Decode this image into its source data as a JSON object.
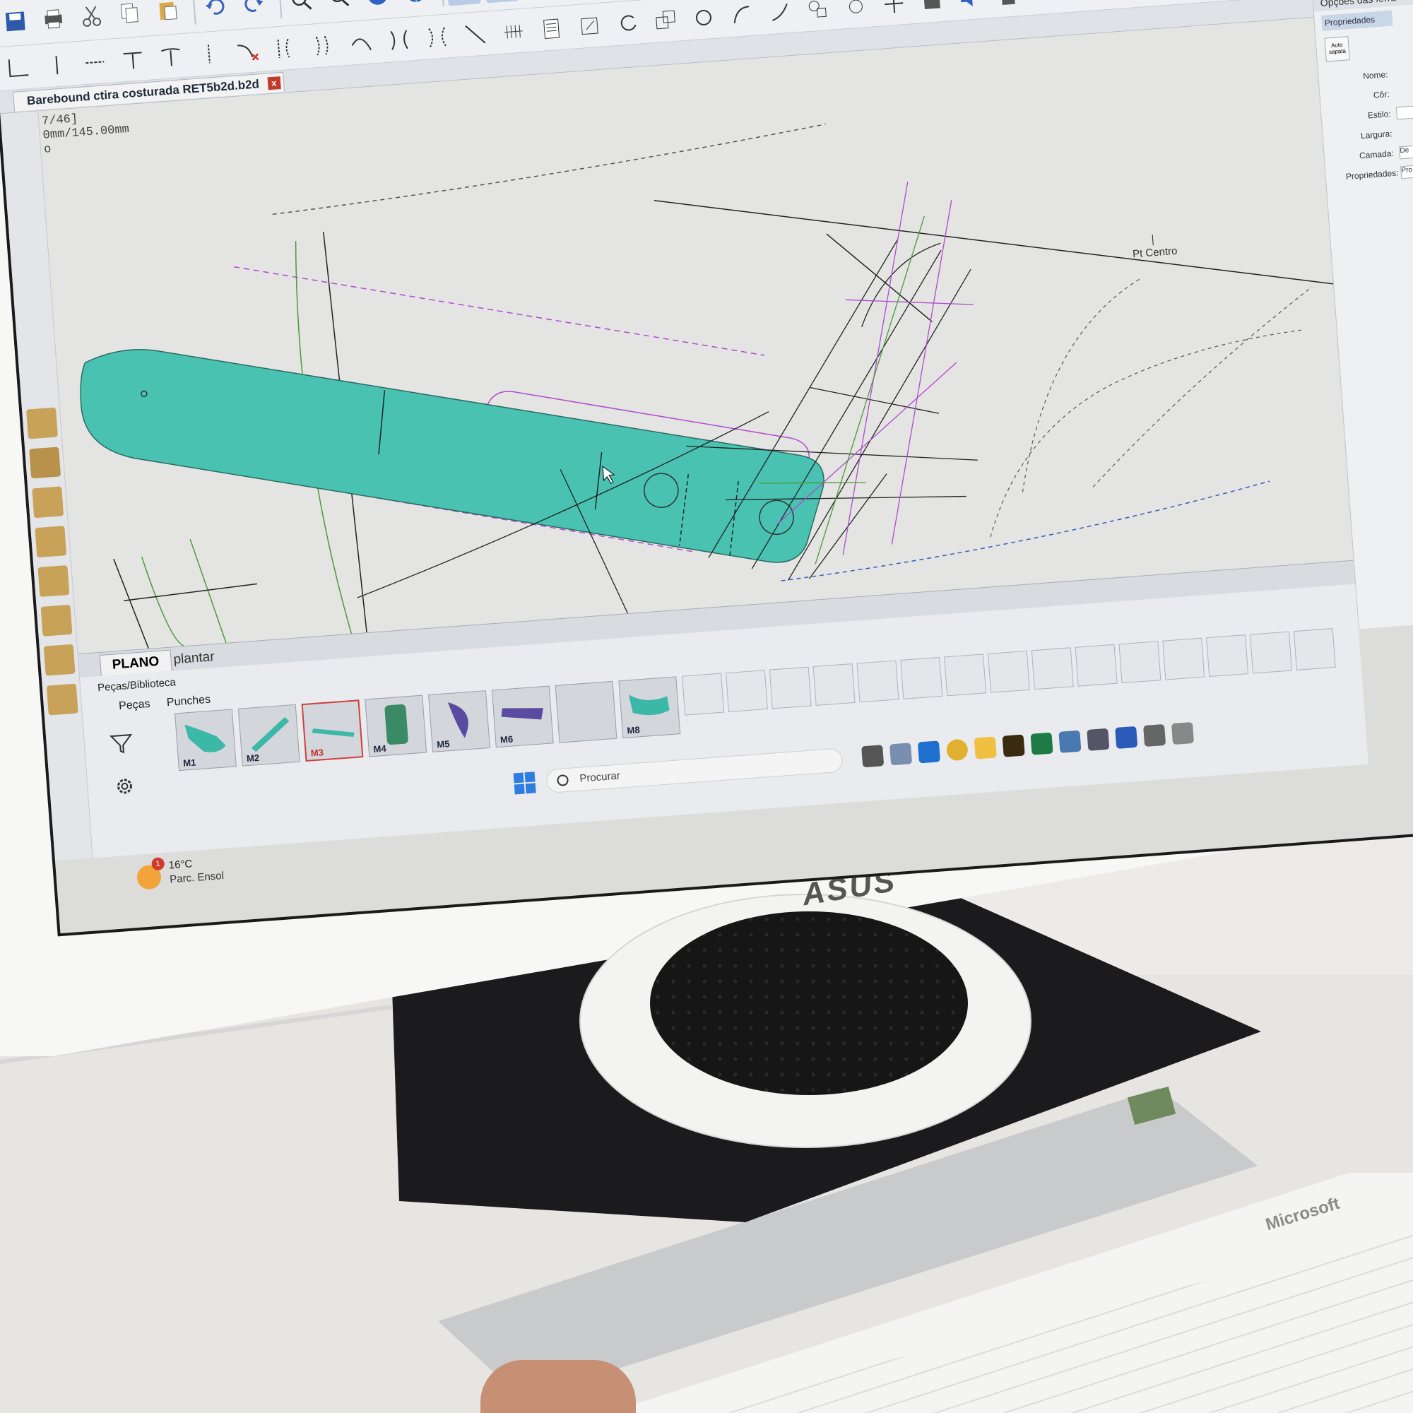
{
  "app": {
    "document_tab": "Barebound ctira costurada RET5b2d.b2d",
    "document_tab_close": "x"
  },
  "canvas": {
    "status_line1": "7/46]",
    "status_line2": "0mm/145.00mm",
    "status_line3": "o",
    "center_point_label": "Pt Centro"
  },
  "right_panel": {
    "header": "Opções das ferra",
    "tab": "Propriedades",
    "auto_button": "Auto sapata",
    "fields": [
      {
        "label": "Nome:"
      },
      {
        "label": "Côr:"
      },
      {
        "label": "Estilo:"
      },
      {
        "label": "Largura:"
      },
      {
        "label": "Camada:",
        "value": "De"
      },
      {
        "label": "Propriedades:",
        "value": "Pro"
      }
    ]
  },
  "bottom_tabs": {
    "active": "PLANO",
    "other": "plantar"
  },
  "library": {
    "title": "Peças/Biblioteca",
    "tabs": [
      "Peças",
      "Punches"
    ],
    "items": [
      {
        "label": "M1",
        "color": "#3bb8a6",
        "selected": false
      },
      {
        "label": "M2",
        "color": "#3bb8a6",
        "selected": false
      },
      {
        "label": "M3",
        "color": "#3bb8a6",
        "selected": true
      },
      {
        "label": "M4",
        "color": "#3a8a66",
        "selected": false
      },
      {
        "label": "M5",
        "color": "#5a4aa0",
        "selected": false
      },
      {
        "label": "M6",
        "color": "#5a4aa0",
        "selected": false
      },
      {
        "label": "",
        "color": "",
        "selected": false
      },
      {
        "label": "M8",
        "color": "#3bb8a6",
        "selected": false
      }
    ]
  },
  "weather": {
    "temperature": "16°C",
    "condition": "Parc. Ensol",
    "notification_count": "1"
  },
  "taskbar": {
    "search_placeholder": "Procurar"
  },
  "hardware": {
    "monitor_brand": "ASUS",
    "keyboard_brand": "Microsoft"
  },
  "colors": {
    "piece_fill": "#49c2b1",
    "guide_magenta": "#b04ad0",
    "guide_green": "#4a9a3a",
    "guide_black": "#222222",
    "toolbar_active": "#b9cbe6"
  }
}
